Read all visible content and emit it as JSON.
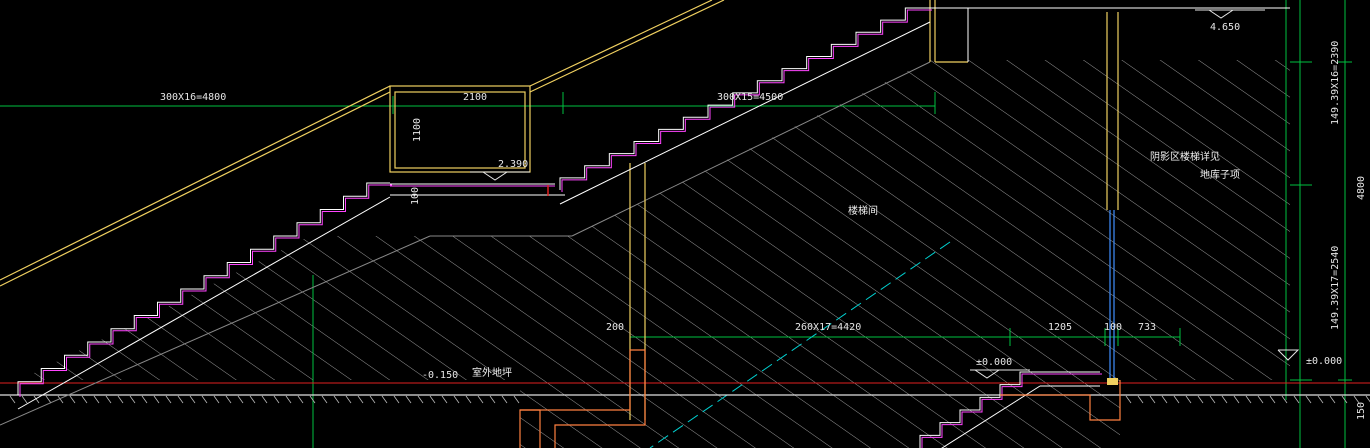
{
  "colors": {
    "background": "#000000",
    "stair_outline": "#ffffff",
    "stair_nosing": "#ff44ff",
    "rail": "#f0d060",
    "dimension": "#00c040",
    "hatch": "#c8c8c8",
    "ground_line": "#e00000",
    "structure": "#ff8040",
    "glass": "#4090ff",
    "cyan_line": "#00d0d0"
  },
  "labels": {
    "dim_stair1": "300X16=4800",
    "dim_landing": "2100",
    "dim_stair2": "300X15=4500",
    "dim_rail_height": "1100",
    "dim_rail_small": "100",
    "elev_landing": "2.390",
    "elev_top": "4.650",
    "elev_ground": "-0.150",
    "ground_text": "室外地坪",
    "elev_zero_left": "±0.000",
    "elev_zero_right": "±0.000",
    "dim_wall_200": "200",
    "dim_basement_steps": "260X17=4420",
    "dim_1205": "1205",
    "dim_100": "100",
    "dim_733": "733",
    "room_label": "楼梯间",
    "note_line1": "阴影区楼梯详见",
    "note_line2": "地库子项",
    "dim_right_top": "149.39X16=2390",
    "dim_right_mid": "4800",
    "dim_right_bottom": "149.39X17=2540",
    "dim_right_150": "150"
  }
}
